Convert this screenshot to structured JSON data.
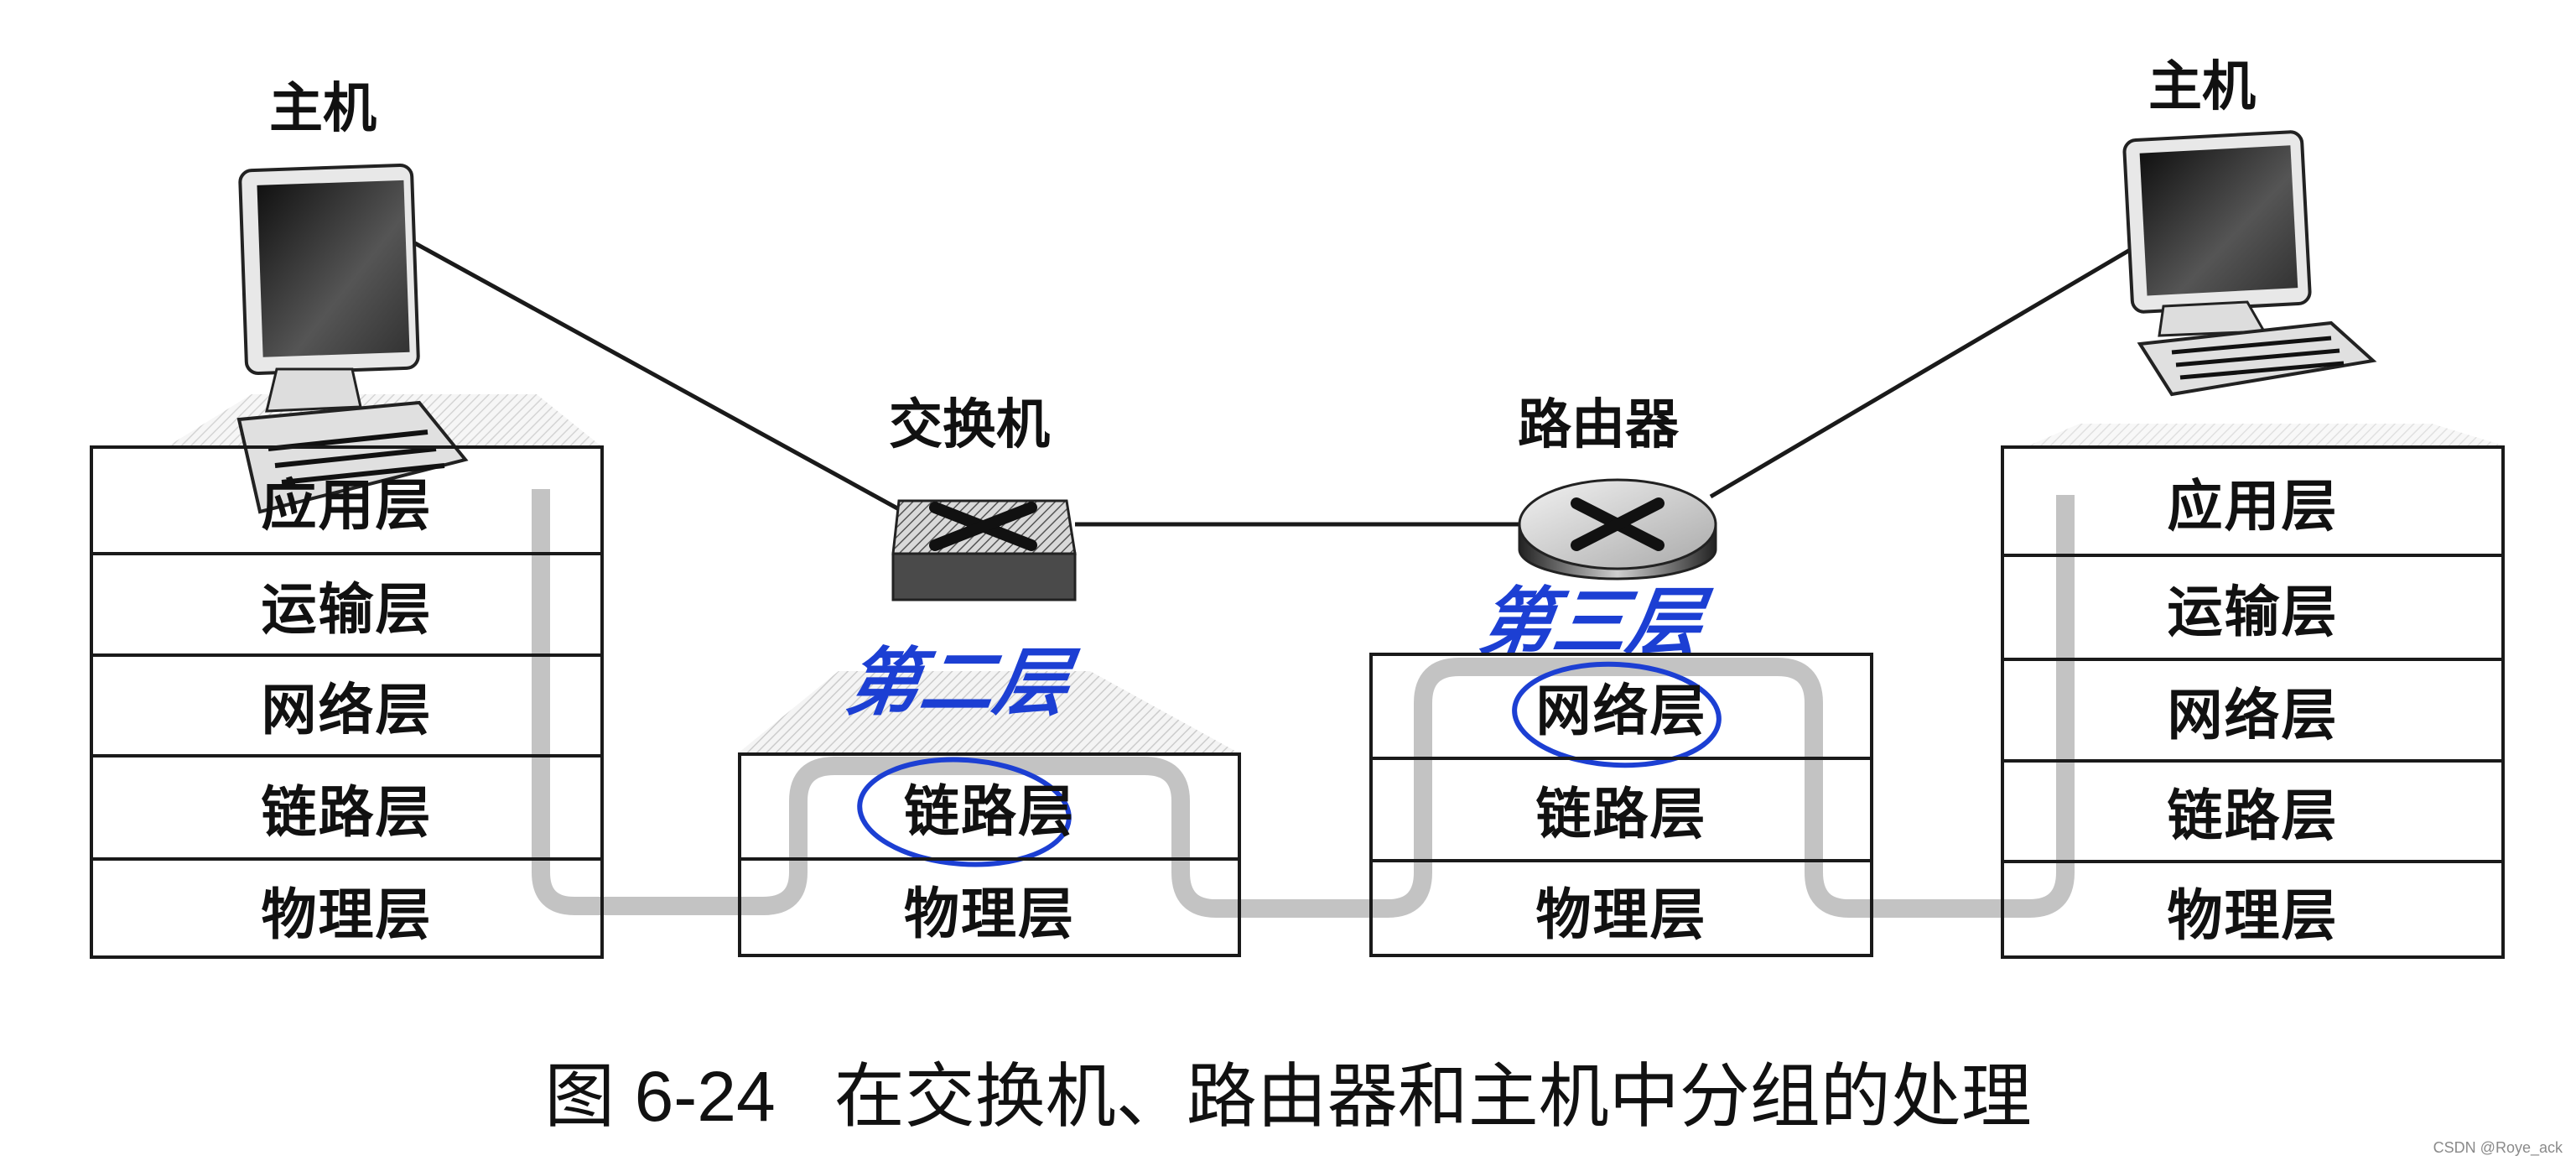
{
  "devices": {
    "host_left": {
      "label": "主机"
    },
    "switch": {
      "label": "交换机",
      "annotation": "第二层"
    },
    "router": {
      "label": "路由器",
      "annotation": "第三层"
    },
    "host_right": {
      "label": "主机"
    }
  },
  "stacks": {
    "host_left": [
      "应用层",
      "运输层",
      "网络层",
      "链路层",
      "物理层"
    ],
    "switch": [
      "链路层",
      "物理层"
    ],
    "router": [
      "网络层",
      "链路层",
      "物理层"
    ],
    "host_right": [
      "应用层",
      "运输层",
      "网络层",
      "链路层",
      "物理层"
    ]
  },
  "caption": {
    "number": "图 6-24",
    "text": "在交换机、路由器和主机中分组的处理"
  },
  "watermark": "CSDN @Roye_ack",
  "colors": {
    "annotation": "#1c3fd3",
    "pipe": "#bdbdbd",
    "line": "#1a1a1a"
  }
}
